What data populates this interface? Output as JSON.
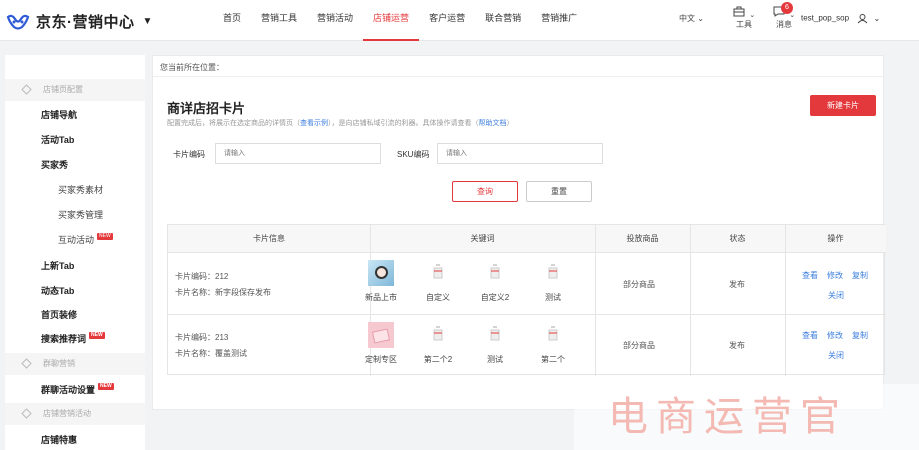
{
  "header": {
    "logo_text": "京东·营销中心",
    "caret": "▼",
    "nav": [
      "首页",
      "营销工具",
      "营销活动",
      "店铺运营",
      "客户运营",
      "联合营销",
      "营销推广"
    ],
    "active_nav": "店铺运营",
    "lang": "中文 ⌄",
    "tools_label": "工具",
    "msg_label": "消息",
    "msg_count": "6",
    "username": "test_pop_sop"
  },
  "sidebar": {
    "group1": "店铺页配置",
    "items1": [
      "店铺导航",
      "活动Tab",
      "买家秀"
    ],
    "subitems": [
      "买家秀素材",
      "买家秀管理",
      "互动活动"
    ],
    "items2": [
      "上新Tab",
      "动态Tab",
      "首页装修",
      "搜索推荐词"
    ],
    "group2": "群聊营销",
    "item_group2": "群聊活动设置",
    "group3": "店铺营销活动",
    "item_group3": "店铺特惠",
    "new_tag": "NEW"
  },
  "main": {
    "breadcrumb": "您当前所在位置：",
    "title": "商详店招卡片",
    "desc_prefix": "配置完成后，将展示在选定商品的详情页（",
    "desc_link1": "查看示例",
    "desc_mid": "），是向店铺私域引流的利器。具体操作请查看（",
    "desc_link2": "帮助文档",
    "desc_suffix": "）",
    "new_button": "新建卡片",
    "filter": {
      "card_code_label": "卡片编码",
      "card_code_placeholder": "请输入",
      "sku_label": "SKU编码",
      "sku_placeholder": "请输入",
      "query_button": "查询",
      "reset_button": "重置"
    },
    "table": {
      "columns": [
        "卡片信息",
        "关键词",
        "投放商品",
        "状态",
        "操作"
      ],
      "rows": [
        {
          "code": "卡片编码：212",
          "name": "卡片名称：新字段保存发布",
          "keywords": [
            "新品上市",
            "自定义",
            "自定义2",
            "测试"
          ],
          "goods": "部分商品",
          "status": "发布",
          "ops": [
            "查看",
            "修改",
            "复制",
            "关闭"
          ]
        },
        {
          "code": "卡片编码：213",
          "name": "卡片名称：覆盖测试",
          "keywords": [
            "定制专区",
            "第二个2",
            "测试",
            "第二个"
          ],
          "goods": "部分商品",
          "status": "发布",
          "ops": [
            "查看",
            "修改",
            "复制",
            "关闭"
          ]
        }
      ]
    }
  },
  "watermark": "电商运营官",
  "colors": {
    "accent": "#e4393c",
    "link": "#3b7ddd"
  }
}
